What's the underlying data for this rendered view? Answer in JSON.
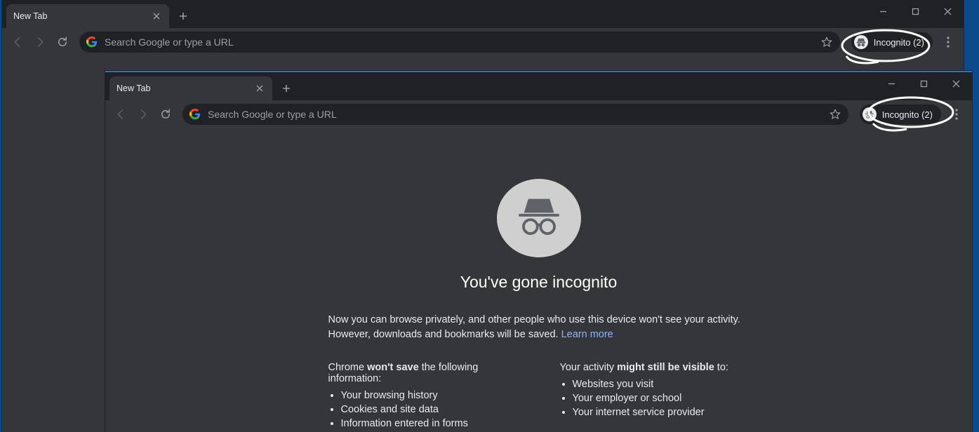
{
  "backWindow": {
    "tab": {
      "title": "New Tab"
    },
    "omnibox": {
      "placeholder": "Search Google or type a URL"
    },
    "incognito": {
      "label": "Incognito (2)"
    }
  },
  "frontWindow": {
    "tab": {
      "title": "New Tab"
    },
    "omnibox": {
      "placeholder": "Search Google or type a URL"
    },
    "incognito": {
      "label": "Incognito (2)"
    }
  },
  "landing": {
    "headline": "You've gone incognito",
    "intro_before": "Now you can browse privately, and other people who use this device won't see your activity. However, downloads and bookmarks will be saved. ",
    "intro_link": "Learn more",
    "left": {
      "lead_pre": "Chrome ",
      "lead_strong": "won't save",
      "lead_post": " the following information:",
      "items": [
        "Your browsing history",
        "Cookies and site data",
        "Information entered in forms"
      ]
    },
    "right": {
      "lead_pre": "Your activity ",
      "lead_strong": "might still be visible",
      "lead_post": " to:",
      "items": [
        "Websites you visit",
        "Your employer or school",
        "Your internet service provider"
      ]
    }
  }
}
